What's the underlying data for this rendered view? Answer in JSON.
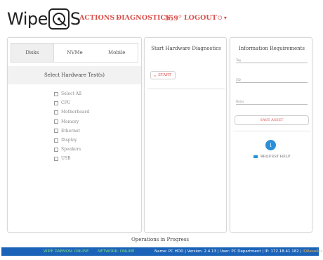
{
  "header": {
    "logo": {
      "prefix": "Wipe",
      "suffix": "S"
    },
    "nav": [
      {
        "label": "ACTIONS",
        "caret": "▾"
      },
      {
        "label": "DIAGNOSTICS"
      },
      {
        "label": "359",
        "sup": "⊙"
      },
      {
        "label": "LOGOUT"
      }
    ],
    "power": "⏻ ▾"
  },
  "left_panel": {
    "tabs": [
      "Disks",
      "NVMe",
      "Mobile"
    ],
    "active_tab": "Disks",
    "section_title": "Select Hardware Test(s)",
    "items": [
      "Select All",
      "CPU",
      "Motherboard",
      "Memory",
      "Ethernet",
      "Display",
      "Speakers",
      "USB"
    ]
  },
  "middle_panel": {
    "title": "Start Hardware Diagnostics",
    "start_label": "START",
    "start_icon": "▸"
  },
  "right_panel": {
    "title": "Information Requirements",
    "fields": [
      "Tag",
      "SID",
      "Notes"
    ],
    "save_label": "SAVE ASSET",
    "info_glyph": "i",
    "request_help_label": "REQUEST HELP"
  },
  "operations_label": "Operations in Progress",
  "status": {
    "wipe": "WIPE DAEMON: ONLINE",
    "network": "NETWORK: ONLINE",
    "info": "Name: PC HDD | Version: 2.4.13 | User: PC Department | IP: 172.18.41.182 | ",
    "reseller": "IQReseller"
  },
  "colors": {
    "accent": "#d9534f",
    "statusbar": "#1a63b8",
    "online": "#7fe07f",
    "info_circle": "#2a8fd8"
  }
}
